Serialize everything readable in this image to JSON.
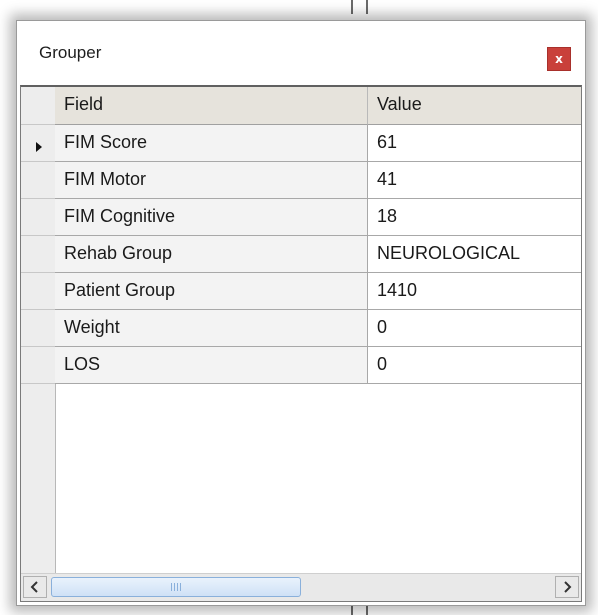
{
  "window": {
    "title": "Grouper",
    "close_label": "x"
  },
  "grid": {
    "columns": [
      "Field",
      "Value"
    ],
    "rows": [
      {
        "field": "FIM Score",
        "value": "61"
      },
      {
        "field": "FIM Motor",
        "value": "41"
      },
      {
        "field": "FIM Cognitive",
        "value": "18"
      },
      {
        "field": "Rehab Group",
        "value": "NEUROLOGICAL"
      },
      {
        "field": "Patient Group",
        "value": "1410"
      },
      {
        "field": "Weight",
        "value": "0"
      },
      {
        "field": "LOS",
        "value": "0"
      }
    ],
    "current_row": "FIM Score"
  },
  "icons": {
    "row_pointer": "current-row-arrow-icon",
    "scroll_left": "chevron-left-icon",
    "scroll_right": "chevron-right-icon",
    "close": "close-icon"
  },
  "colors": {
    "close_button": "#c9403a",
    "header_bg": "#e6e3dc",
    "scroll_thumb": "#cfe1f6"
  }
}
